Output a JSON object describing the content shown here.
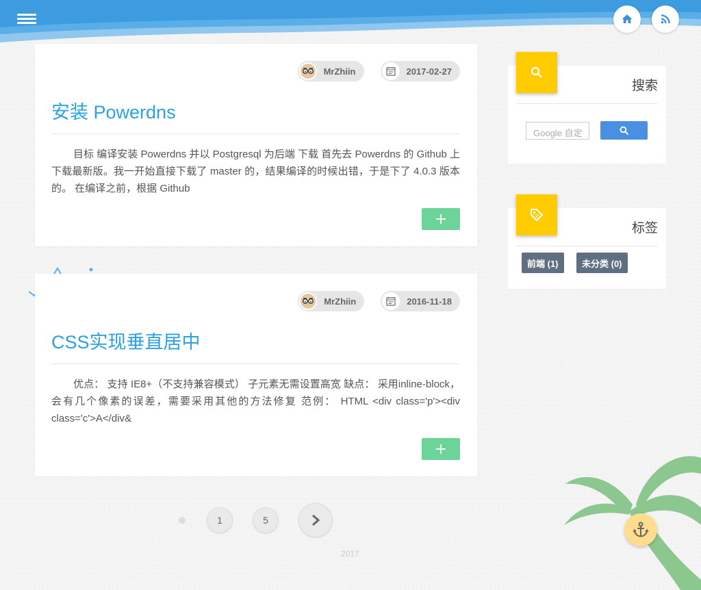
{
  "header": {
    "menu_icon": "hamburger-menu-icon",
    "home_icon": "home-icon",
    "rss_icon": "rss-icon",
    "colors": {
      "wave_dark": "#3d9be0",
      "wave_light": "#8fc7ef"
    }
  },
  "posts": [
    {
      "author": "MrZhiin",
      "date": "2017-02-27",
      "title": "安装 Powerdns",
      "excerpt": "目标 编译安装 Powerdns 并以 Postgresql 为后端 下载 首先去 Powerdns 的 Github 上下载最新版。我一开始直接下载了 master 的，结果编译的时候出错，于是下了 4.0.3 版本的。 在编译之前，根据 Github"
    },
    {
      "author": "MrZhiin",
      "date": "2016-11-18",
      "title": "CSS实现垂直居中",
      "excerpt": "优点： 支持 IE8+（不支持兼容模式） 子元素无需设置高宽 缺点： 采用inline-block，会有几个像素的误差，需要采用其他的方法修复 范例： HTML <div class='p'><div class='c'>A</div&"
    }
  ],
  "sidebar": {
    "search": {
      "title": "搜索",
      "placeholder": "Google 自定",
      "icon": "search-icon"
    },
    "tags": {
      "title": "标签",
      "icon": "tag-icon",
      "items": [
        "前端 (1)",
        "未分类 (0)"
      ]
    }
  },
  "pagination": {
    "pages": [
      "1",
      "5"
    ],
    "next_icon": "chevron-right-icon"
  },
  "footer": {
    "year": "2017"
  },
  "accent_colors": {
    "title_blue": "#2ba2e0",
    "badge_yellow": "#ffcc00",
    "more_green": "#6cd399",
    "tag_gray": "#5f6f81"
  }
}
